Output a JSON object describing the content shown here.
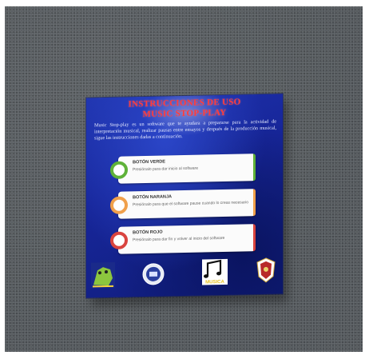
{
  "poster": {
    "title_line1": "INSTRUCCIONES DE USO",
    "title_line2": "MUSIC STOP-PLAY",
    "intro": "Music Stop-play es un software que te ayudara a prepararse para la actividad de interpretación musical, realizar pausas entre ensayos y después de la producción musical, sigue las instrucciones dadas a continuación.",
    "buttons": [
      {
        "title": "BOTÓN VERDE",
        "desc": "Presiónalo para dar inicio al software",
        "color": "#5fb239"
      },
      {
        "title": "BOTÓN NARANJA",
        "desc": "Presiónalo para que el software pause cuando lo creas necesario",
        "color": "#f0a04b"
      },
      {
        "title": "BOTÓN ROJO",
        "desc": "Presiónalo para dar fin y volver al inicio del software",
        "color": "#d9443f"
      }
    ],
    "logos": {
      "music_label": "MUSICA"
    }
  }
}
